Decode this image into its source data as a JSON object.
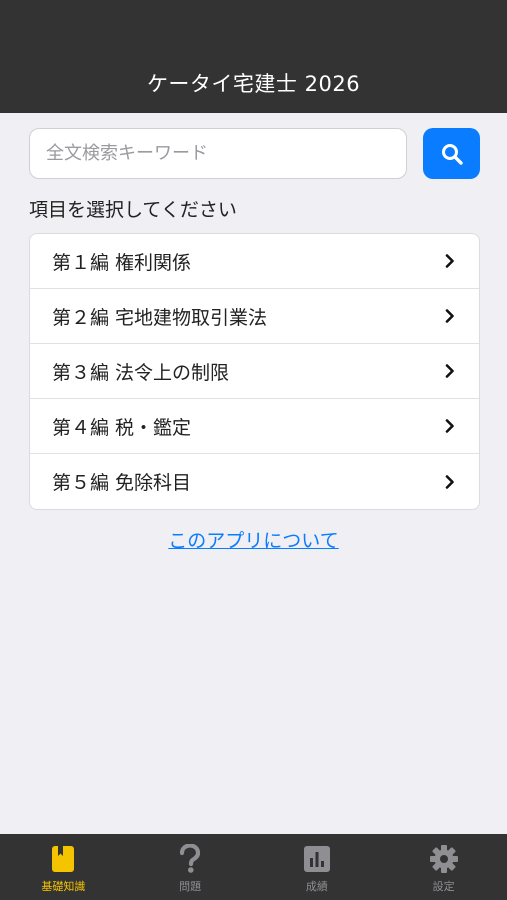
{
  "header": {
    "title": "ケータイ宅建士 2026"
  },
  "search": {
    "placeholder": "全文検索キーワード",
    "value": "",
    "button_icon": "search-icon"
  },
  "section_label": "項目を選択してください",
  "items": [
    {
      "label": "第１編 権利関係"
    },
    {
      "label": "第２編 宅地建物取引業法"
    },
    {
      "label": "第３編 法令上の制限"
    },
    {
      "label": "第４編 税・鑑定"
    },
    {
      "label": "第５編 免除科目"
    }
  ],
  "about_link": "このアプリについて",
  "tabs": [
    {
      "label": "基礎知識",
      "icon": "book-icon",
      "active": true
    },
    {
      "label": "問題",
      "icon": "question-icon",
      "active": false
    },
    {
      "label": "成績",
      "icon": "bar-chart-icon",
      "active": false
    },
    {
      "label": "設定",
      "icon": "gear-icon",
      "active": false
    }
  ],
  "colors": {
    "header_bg": "#333333",
    "accent": "#0a7cff",
    "active_tab": "#f5c400",
    "background": "#efeff4"
  }
}
